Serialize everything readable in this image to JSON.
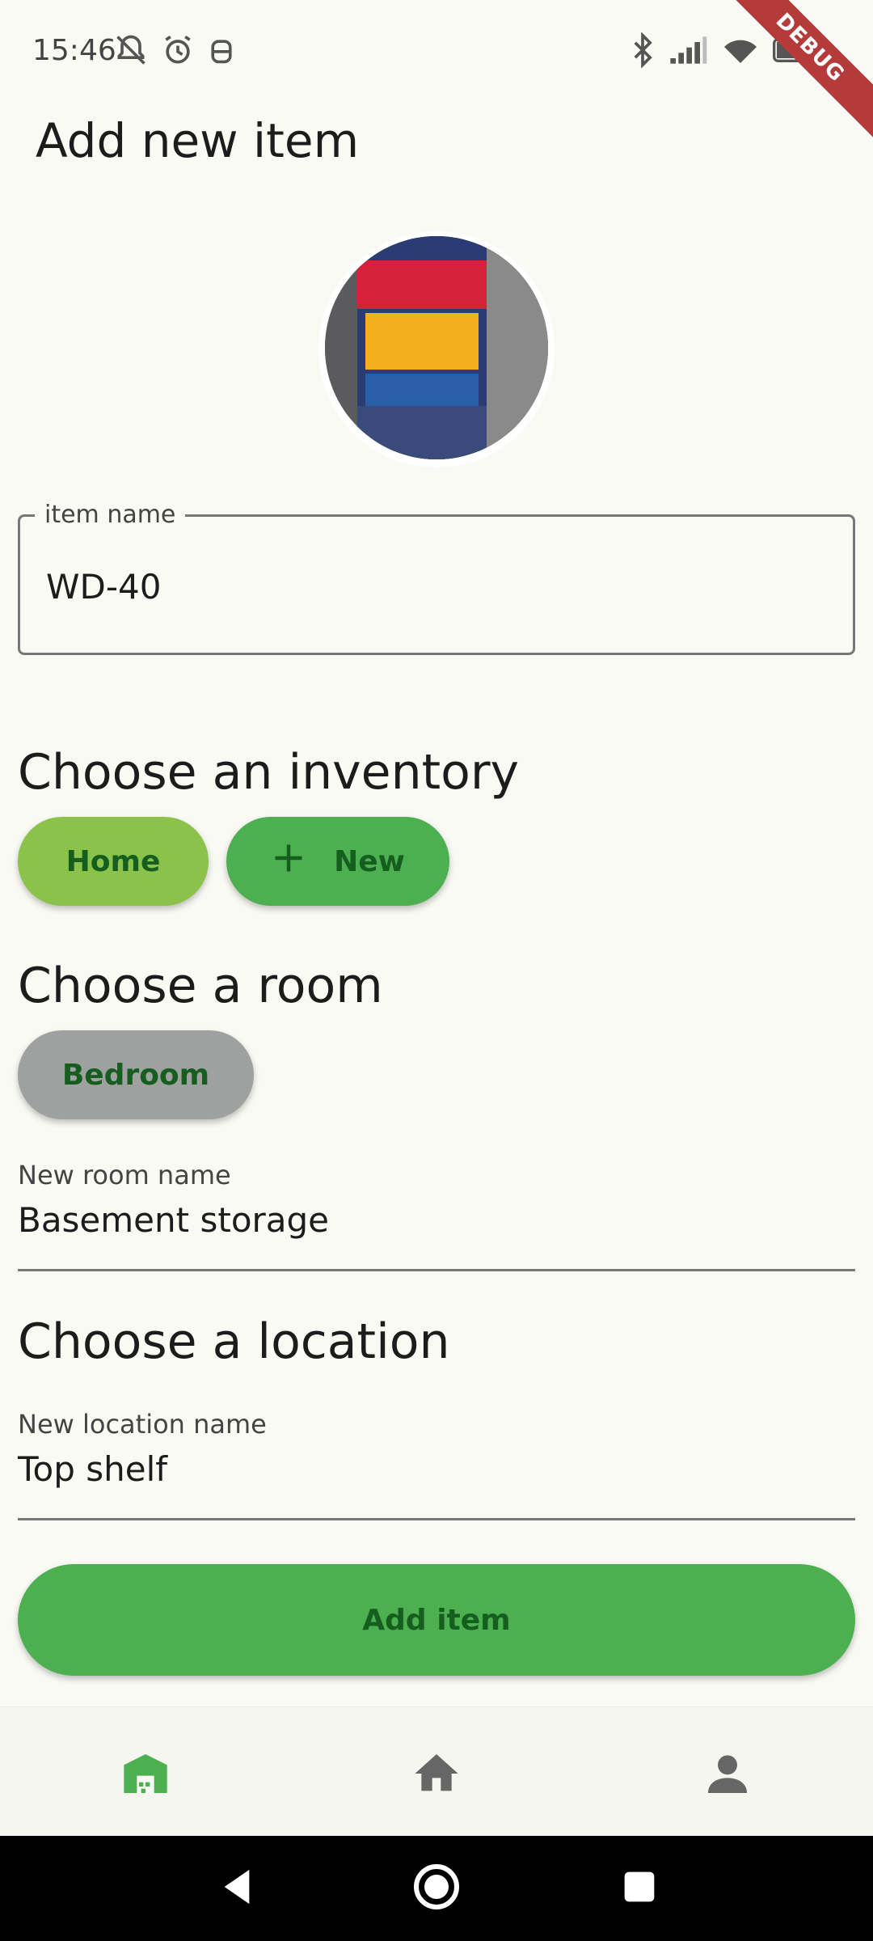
{
  "status_bar": {
    "time": "15:46",
    "battery_level": "44",
    "icons": [
      "do-not-disturb-icon",
      "alarm-icon",
      "android-debug-icon",
      "bluetooth-icon",
      "signal-icon",
      "wifi-icon",
      "battery-icon"
    ]
  },
  "debug_banner": "DEBUG",
  "page": {
    "title": "Add new item"
  },
  "item_image": {
    "icon": "item-photo"
  },
  "item_name_field": {
    "label": "item name",
    "value": "WD-40"
  },
  "inventory_section": {
    "title": "Choose an inventory",
    "chips": [
      {
        "label": "Home",
        "color": "#8bc34a"
      },
      {
        "label": "New",
        "icon": "plus-icon",
        "color": "#4caf50"
      }
    ]
  },
  "room_section": {
    "title": "Choose a room",
    "chips": [
      {
        "label": "Bedroom",
        "color": "#9ea19f"
      }
    ],
    "new_room_field": {
      "label": "New room name",
      "value": "Basement storage"
    }
  },
  "location_section": {
    "title": "Choose a location",
    "new_location_field": {
      "label": "New location name",
      "value": "Top shelf"
    }
  },
  "submit": {
    "label": "Add item",
    "color": "#4caf50"
  },
  "bottom_nav": {
    "items": [
      {
        "icon": "warehouse-icon",
        "active": true
      },
      {
        "icon": "home-icon",
        "active": false
      },
      {
        "icon": "person-icon",
        "active": false
      }
    ],
    "active_color": "#4caf50",
    "inactive_color": "#666666"
  },
  "system_nav": {
    "icons": [
      "back-icon",
      "home-circle-icon",
      "recents-icon"
    ]
  }
}
